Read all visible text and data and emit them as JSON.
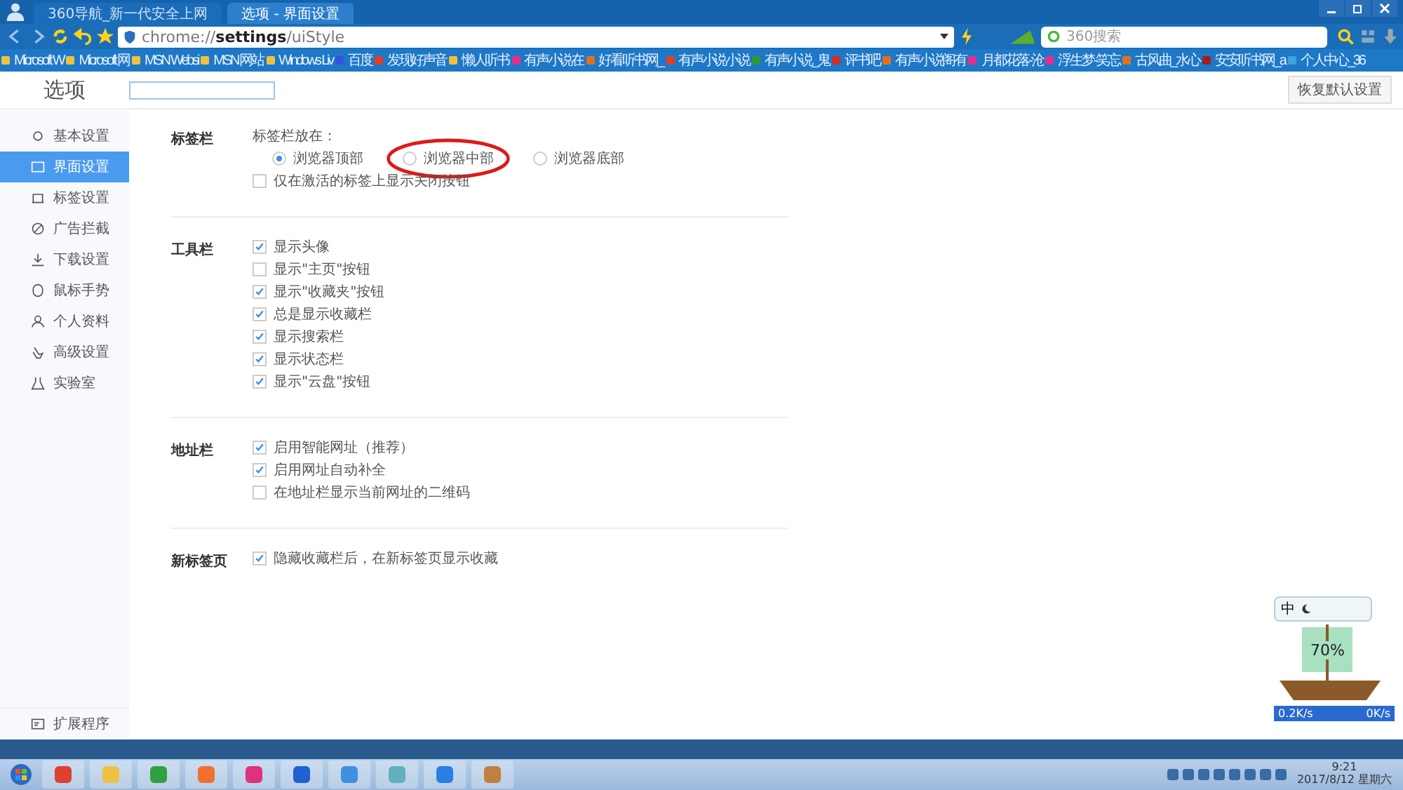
{
  "tabs": [
    {
      "title": "360导航_新一代安全上网",
      "selected": false
    },
    {
      "title": "选项 - 界面设置",
      "selected": true
    }
  ],
  "address": {
    "value": "chrome://**settings**/uiStyle"
  },
  "search": {
    "placeholder": "360搜索"
  },
  "bookmarks": [
    {
      "label": "Microsoft W",
      "color": "#f0c040"
    },
    {
      "label": "Microsoft 网",
      "color": "#f0c040"
    },
    {
      "label": "MSN Websi",
      "color": "#f0c040"
    },
    {
      "label": "MSN 网站",
      "color": "#f0c040"
    },
    {
      "label": "Windows Liv",
      "color": "#f0c040"
    },
    {
      "label": "百度",
      "color": "#3355dd"
    },
    {
      "label": "发现好声音",
      "color": "#e04020"
    },
    {
      "label": "懒人听书",
      "color": "#f0c040"
    },
    {
      "label": "有声小说在",
      "color": "#e0308a"
    },
    {
      "label": "好看听书网_",
      "color": "#e07020"
    },
    {
      "label": "有声小说小说",
      "color": "#e04020"
    },
    {
      "label": "有声小说_鬼",
      "color": "#2a9a30"
    },
    {
      "label": "评书吧",
      "color": "#d03020"
    },
    {
      "label": "有声小说阁有",
      "color": "#e07020"
    },
    {
      "label": "月都花落-沧",
      "color": "#e0308a"
    },
    {
      "label": "浮生梦-笑忘",
      "color": "#e0308a"
    },
    {
      "label": "古风曲_水心",
      "color": "#e07020"
    },
    {
      "label": "安安听书网_a",
      "color": "#a02020"
    },
    {
      "label": "个人中心_36",
      "color": "#40a0e0"
    }
  ],
  "page": {
    "title": "选项",
    "reset_button": "恢复默认设置"
  },
  "sidebar": {
    "items": [
      {
        "label": "基本设置",
        "selected": false
      },
      {
        "label": "界面设置",
        "selected": true
      },
      {
        "label": "标签设置",
        "selected": false
      },
      {
        "label": "广告拦截",
        "selected": false
      },
      {
        "label": "下载设置",
        "selected": false
      },
      {
        "label": "鼠标手势",
        "selected": false
      },
      {
        "label": "个人资料",
        "selected": false
      },
      {
        "label": "高级设置",
        "selected": false
      },
      {
        "label": "实验室",
        "selected": false
      }
    ],
    "footer": "扩展程序"
  },
  "sections": [
    {
      "label": "标签栏",
      "rows": [
        {
          "kind": "text",
          "label": "标签栏放在："
        },
        {
          "kind": "radios",
          "options": [
            {
              "label": "浏览器顶部",
              "selected": true
            },
            {
              "label": "浏览器中部",
              "selected": false
            },
            {
              "label": "浏览器底部",
              "selected": false
            }
          ]
        },
        {
          "kind": "checkbox",
          "label": "仅在激活的标签上显示关闭按钮",
          "checked": false
        }
      ]
    },
    {
      "label": "工具栏",
      "rows": [
        {
          "kind": "checkbox",
          "label": "显示头像",
          "checked": true
        },
        {
          "kind": "checkbox",
          "label": "显示\"主页\"按钮",
          "checked": false
        },
        {
          "kind": "checkbox",
          "label": "显示\"收藏夹\"按钮",
          "checked": true
        },
        {
          "kind": "checkbox",
          "label": "总是显示收藏栏",
          "checked": true
        },
        {
          "kind": "checkbox",
          "label": "显示搜索栏",
          "checked": true
        },
        {
          "kind": "checkbox",
          "label": "显示状态栏",
          "checked": true
        },
        {
          "kind": "checkbox",
          "label": "显示\"云盘\"按钮",
          "checked": true
        }
      ]
    },
    {
      "label": "地址栏",
      "rows": [
        {
          "kind": "checkbox",
          "label": "启用智能网址（推荐）",
          "checked": true
        },
        {
          "kind": "checkbox",
          "label": "启用网址自动补全",
          "checked": true
        },
        {
          "kind": "checkbox",
          "label": "在地址栏显示当前网址的二维码",
          "checked": false
        }
      ]
    },
    {
      "label": "新标签页",
      "rows": [
        {
          "kind": "checkbox",
          "label": "隐藏收藏栏后，在新标签页显示收藏",
          "checked": true
        }
      ]
    }
  ],
  "widget": {
    "ime": "中",
    "percent": "70%",
    "upload": "0.2K/s",
    "download": "0K/s"
  },
  "clock": {
    "time": "9:21",
    "date": "2017/8/12 星期六"
  }
}
